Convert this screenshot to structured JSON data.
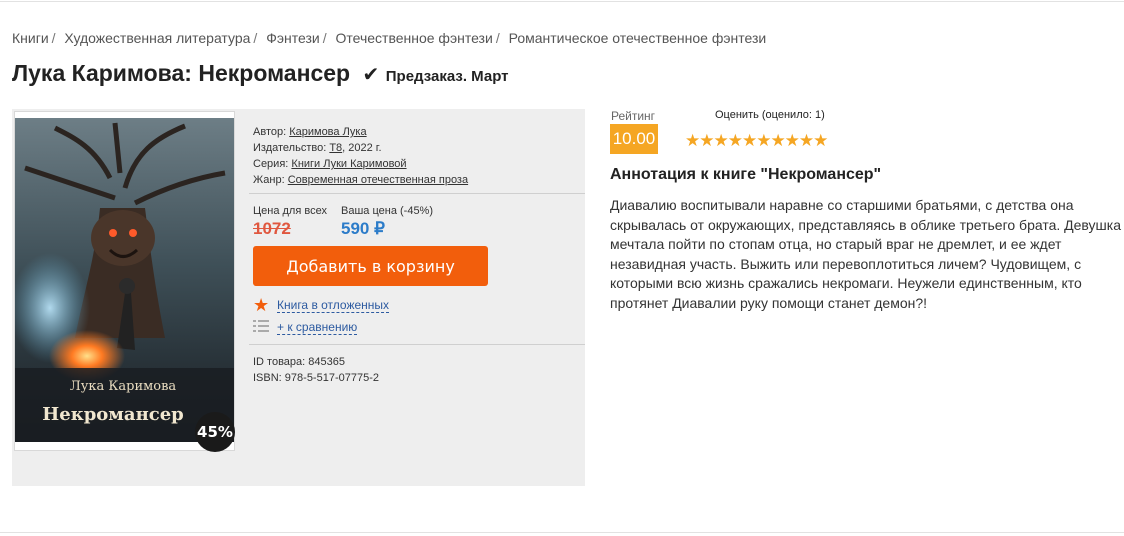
{
  "breadcrumb": [
    "Книги",
    "Художественная литература",
    "Фэнтези",
    "Отечественное фэнтези",
    "Романтическое отечественное фэнтези"
  ],
  "title": "Лука Каримова: Некромансер",
  "status": "Предзаказ. Март",
  "cover": {
    "author_text": "Лука Каримова",
    "title_text": "Некромансер",
    "discount_badge": "45%"
  },
  "meta": {
    "author_label": "Автор:",
    "author": "Каримова Лука",
    "publisher_label": "Издательство:",
    "publisher": "Т8",
    "year": ", 2022 г.",
    "series_label": "Серия:",
    "series": "Книги Луки Каримовой",
    "genre_label": "Жанр:",
    "genre": "Современная отечественная проза"
  },
  "price": {
    "all_label": "Цена для всех",
    "your_label": "Ваша цена (-45%)",
    "old": "1072",
    "new": "590 ₽"
  },
  "cart_button": "Добавить в корзину",
  "wishlist": "Книга в отложенных",
  "compare": "+ к сравнению",
  "ids": {
    "id_label": "ID товара:",
    "id": "845365",
    "isbn_label": "ISBN:",
    "isbn": "978-5-517-07775-2"
  },
  "rating": {
    "label": "Рейтинг",
    "value": "10.00",
    "rate_label": "Оценить (оценило: 1)",
    "stars": "★★★★★★★★★★"
  },
  "annotation": {
    "title": "Аннотация к книге \"Некромансер\"",
    "text": "Диавалию воспитывали наравне со старшими братьями, с детства она скрывалась от окружающих, представляясь в облике третьего брата. Девушка мечтала пойти по стопам отца, но старый враг не дремлет, и ее ждет незавидная участь. Выжить или перевоплотиться личем? Чудовищем, с которыми всю жизнь сражались некромаги. Неужели единственным, кто протянет Диавалии руку помощи станет демон?!"
  },
  "colors": {
    "accent": "#f25e0c",
    "link": "#2c5aa0",
    "price_new": "#2c7cc9",
    "price_old": "#e0573f",
    "rating": "#f5a623"
  }
}
